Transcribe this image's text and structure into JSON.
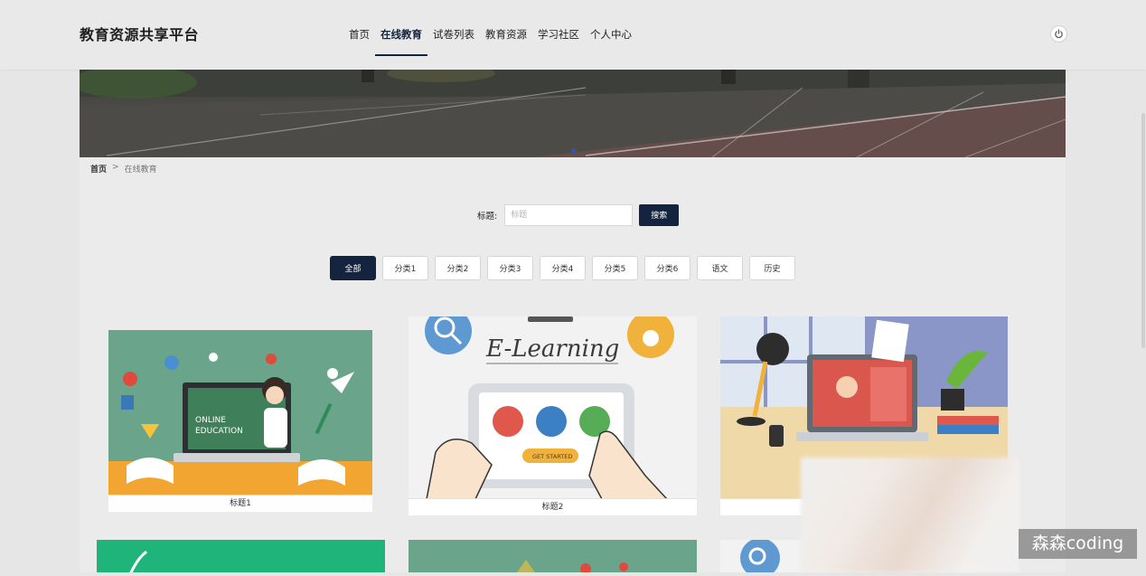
{
  "brand": "教育资源共享平台",
  "nav": [
    {
      "label": "首页"
    },
    {
      "label": "在线教育",
      "active": true
    },
    {
      "label": "试卷列表"
    },
    {
      "label": "教育资源"
    },
    {
      "label": "学习社区"
    },
    {
      "label": "个人中心"
    }
  ],
  "breadcrumb": {
    "home": "首页",
    "sep": ">",
    "current": "在线教育"
  },
  "search": {
    "label": "标题:",
    "placeholder": "标题",
    "value": "",
    "button": "搜索"
  },
  "categories": [
    "全部",
    "分类1",
    "分类2",
    "分类3",
    "分类4",
    "分类5",
    "分类6",
    "语文",
    "历史"
  ],
  "cards": [
    {
      "title": "标题1",
      "image_text": [
        "ONLINE",
        "EDUCATION"
      ]
    },
    {
      "title": "标题2",
      "image_text": [
        "E-Learning",
        "GET STARTED"
      ]
    },
    {
      "title": ""
    }
  ],
  "watermark": "森森coding",
  "icons": {
    "power": "power-icon"
  },
  "colors": {
    "accent": "#14243f",
    "background": "#e6e6e6"
  }
}
